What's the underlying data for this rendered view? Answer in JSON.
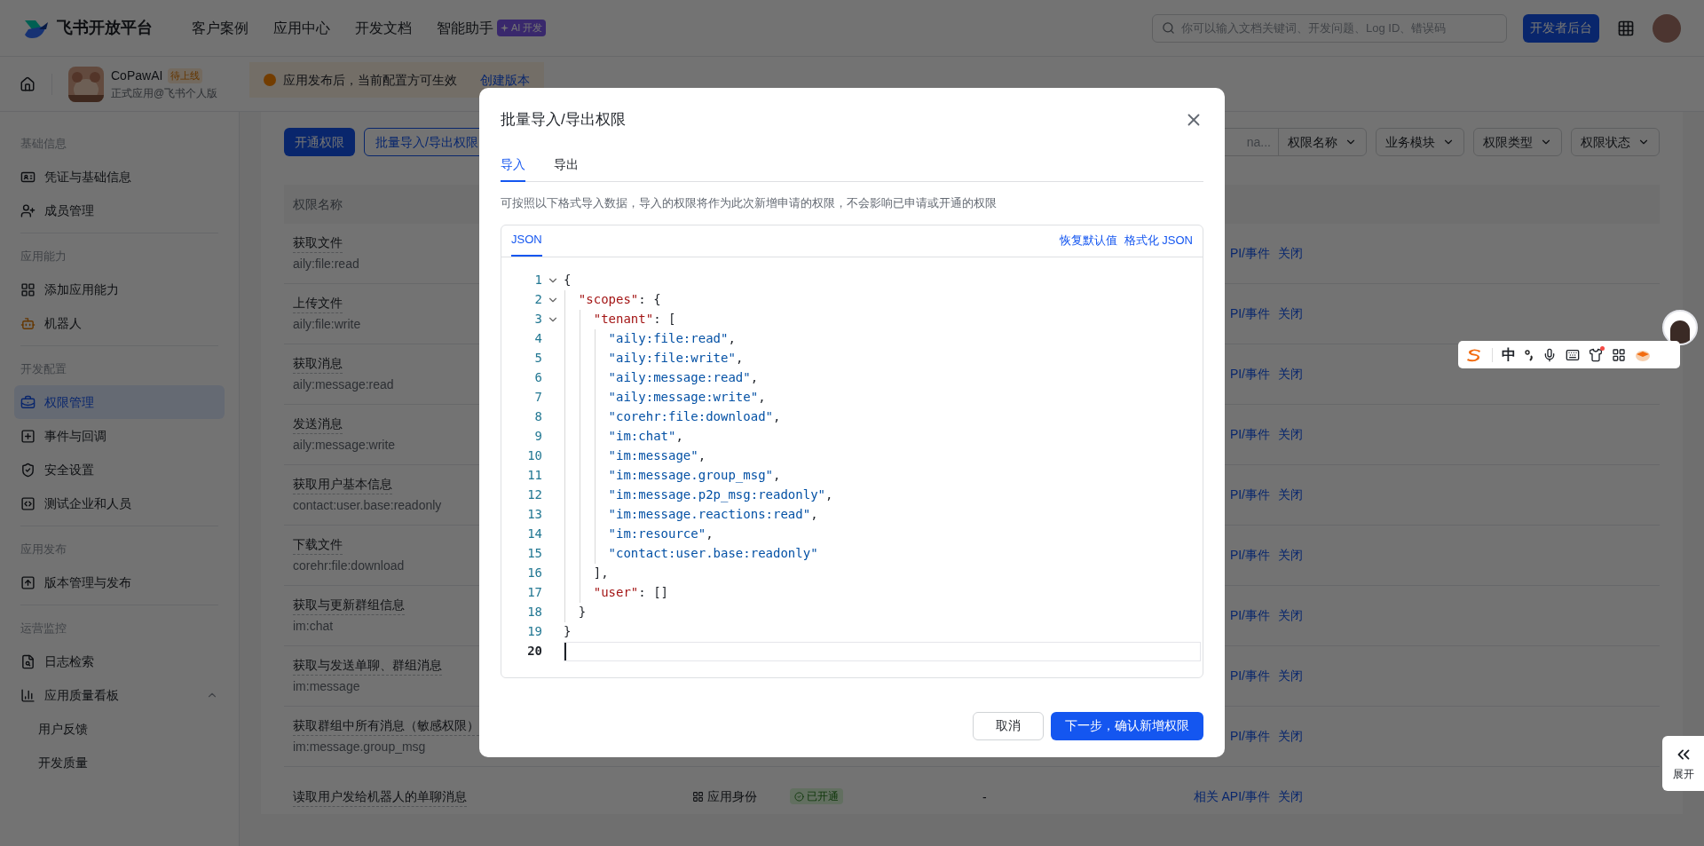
{
  "topbar": {
    "brand": "飞书开放平台",
    "nav": [
      {
        "label": "客户案例"
      },
      {
        "label": "应用中心"
      },
      {
        "label": "开发文档"
      },
      {
        "label": "智能助手",
        "badge": "AI 开发"
      }
    ],
    "search": {
      "placeholder": "你可以输入文档关键词、开发问题、Log ID、错误码"
    },
    "console_button": "开发者后台"
  },
  "app_header": {
    "app_name": "CoPawAI",
    "status_badge": "待上线",
    "app_type": "正式应用@飞书个人版",
    "notice": "应用发布后，当前配置方可生效",
    "notice_link": "创建版本"
  },
  "sidebar": {
    "sections": [
      {
        "title": "基础信息",
        "items": [
          {
            "label": "凭证与基础信息",
            "selected": false
          },
          {
            "label": "成员管理",
            "selected": false
          }
        ]
      },
      {
        "title": "应用能力",
        "items": [
          {
            "label": "添加应用能力",
            "selected": false
          },
          {
            "label": "机器人",
            "selected": false
          }
        ]
      },
      {
        "title": "开发配置",
        "items": [
          {
            "label": "权限管理",
            "selected": true
          },
          {
            "label": "事件与回调",
            "selected": false
          },
          {
            "label": "安全设置",
            "selected": false
          },
          {
            "label": "测试企业和人员",
            "selected": false
          }
        ]
      },
      {
        "title": "应用发布",
        "items": [
          {
            "label": "版本管理与发布",
            "selected": false
          }
        ]
      },
      {
        "title": "运营监控",
        "items": [
          {
            "label": "日志检索",
            "selected": false
          },
          {
            "label": "应用质量看板",
            "selected": false,
            "expanded": true,
            "children": [
              {
                "label": "用户反馈",
                "selected": false
              },
              {
                "label": "开发质量",
                "selected": false
              }
            ]
          }
        ]
      }
    ]
  },
  "toolbar": {
    "buttons": [
      {
        "label": "开通权限",
        "kind": "primary"
      },
      {
        "label": "批量导入/导出权限",
        "kind": "outline"
      }
    ],
    "search_value": "na...",
    "filters": [
      {
        "label": "权限名称",
        "kind": "attached"
      },
      {
        "label": "业务模块",
        "kind": "dropdown"
      },
      {
        "label": "权限类型",
        "kind": "dropdown"
      },
      {
        "label": "权限状态",
        "kind": "dropdown"
      }
    ]
  },
  "table": {
    "columns": [
      {
        "label": "权限名称"
      }
    ],
    "rows": [
      {
        "name": "获取文件",
        "scope": "aily:file:read",
        "api_link": "PI/事件",
        "action": "关闭"
      },
      {
        "name": "上传文件",
        "scope": "aily:file:write",
        "api_link": "PI/事件",
        "action": "关闭"
      },
      {
        "name": "获取消息",
        "scope": "aily:message:read",
        "api_link": "PI/事件",
        "action": "关闭"
      },
      {
        "name": "发送消息",
        "scope": "aily:message:write",
        "api_link": "PI/事件",
        "action": "关闭"
      },
      {
        "name": "获取用户基本信息",
        "scope": "contact:user.base:readonly",
        "api_link": "PI/事件",
        "action": "关闭"
      },
      {
        "name": "下载文件",
        "scope": "corehr:file:download",
        "api_link": "PI/事件",
        "action": "关闭"
      },
      {
        "name": "获取与更新群组信息",
        "scope": "im:chat",
        "api_link": "PI/事件",
        "action": "关闭"
      },
      {
        "name": "获取与发送单聊、群组消息",
        "scope": "im:message",
        "api_link": "PI/事件",
        "action": "关闭"
      },
      {
        "name": "获取群组中所有消息（敏感权限）",
        "scope": "im:message.group_msg",
        "api_link": "PI/事件",
        "action": "关闭"
      },
      {
        "name": "读取用户发给机器人的单聊消息",
        "identity": "应用身份",
        "status": "已开通",
        "column_4": "-",
        "api_link": "相关 API/事件",
        "action": "关闭"
      }
    ]
  },
  "dialog": {
    "title": "批量导入/导出权限",
    "tabs": [
      {
        "label": "导入",
        "selected": true
      },
      {
        "label": "导出",
        "selected": false
      }
    ],
    "description": "可按照以下格式导入数据，导入的权限将作为此次新增申请的权限，不会影响已申请或开通的权限",
    "editor": {
      "tabs": [
        {
          "label": "JSON",
          "selected": true
        }
      ],
      "actions": [
        "恢复默认值",
        "格式化 JSON"
      ],
      "lines": [
        {
          "number": "1",
          "text": "{",
          "foldable": true,
          "active": false
        },
        {
          "number": "2",
          "text": "  \"scopes\": {",
          "foldable": true,
          "active": false
        },
        {
          "number": "3",
          "text": "    \"tenant\": [",
          "foldable": true,
          "active": false
        },
        {
          "number": "4",
          "text": "      \"aily:file:read\",",
          "foldable": false,
          "active": false
        },
        {
          "number": "5",
          "text": "      \"aily:file:write\",",
          "foldable": false,
          "active": false
        },
        {
          "number": "6",
          "text": "      \"aily:message:read\",",
          "foldable": false,
          "active": false
        },
        {
          "number": "7",
          "text": "      \"aily:message:write\",",
          "foldable": false,
          "active": false
        },
        {
          "number": "8",
          "text": "      \"corehr:file:download\",",
          "foldable": false,
          "active": false
        },
        {
          "number": "9",
          "text": "      \"im:chat\",",
          "foldable": false,
          "active": false
        },
        {
          "number": "10",
          "text": "      \"im:message\",",
          "foldable": false,
          "active": false
        },
        {
          "number": "11",
          "text": "      \"im:message.group_msg\",",
          "foldable": false,
          "active": false
        },
        {
          "number": "12",
          "text": "      \"im:message.p2p_msg:readonly\",",
          "foldable": false,
          "active": false
        },
        {
          "number": "13",
          "text": "      \"im:message.reactions:read\",",
          "foldable": false,
          "active": false
        },
        {
          "number": "14",
          "text": "      \"im:resource\",",
          "foldable": false,
          "active": false
        },
        {
          "number": "15",
          "text": "      \"contact:user.base:readonly\"",
          "foldable": false,
          "active": false
        },
        {
          "number": "16",
          "text": "    ],",
          "foldable": false,
          "active": false
        },
        {
          "number": "17",
          "text": "    \"user\": []",
          "foldable": false,
          "active": false
        },
        {
          "number": "18",
          "text": "  }",
          "foldable": false,
          "active": false
        },
        {
          "number": "19",
          "text": "}",
          "foldable": false,
          "active": false
        },
        {
          "number": "20",
          "foldable": false,
          "active": true
        }
      ]
    },
    "buttons": [
      {
        "label": "取消",
        "kind": "secondary"
      },
      {
        "label": "下一步，确认新增权限",
        "kind": "primary"
      }
    ]
  },
  "ime_toolbar": {
    "mode": "中"
  },
  "side_expand": {
    "label": "展开"
  }
}
